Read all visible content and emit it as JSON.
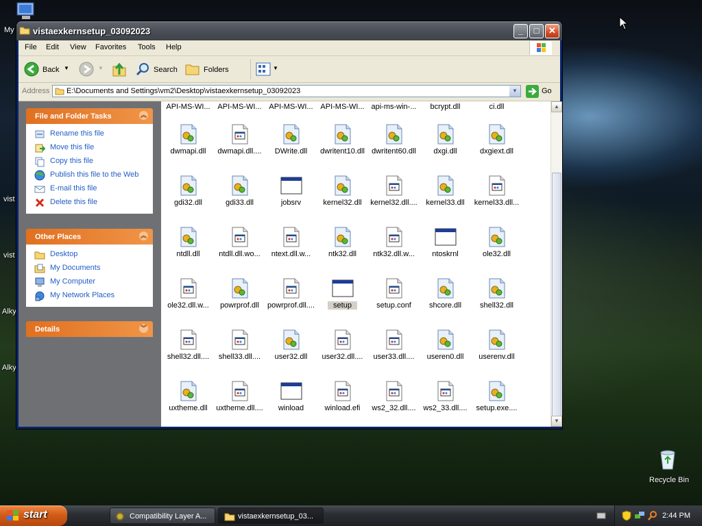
{
  "desktop": {
    "labels": [
      "My",
      "vist",
      "vist",
      "Alky",
      "Alky"
    ],
    "recycle_bin": "Recycle Bin"
  },
  "window": {
    "title": "vistaexkernsetup_03092023",
    "controls": {
      "minimize": "_",
      "maximize": "□",
      "close": "✕"
    },
    "menu": [
      "File",
      "Edit",
      "View",
      "Favorites",
      "Tools",
      "Help"
    ],
    "toolbar": {
      "back": "Back",
      "search": "Search",
      "folders": "Folders"
    },
    "address": {
      "label": "Address",
      "path": "E:\\Documents and Settings\\vm2\\Desktop\\vistaexkernsetup_03092023",
      "go": "Go"
    }
  },
  "sidebar": {
    "file_tasks": {
      "title": "File and Folder Tasks",
      "items": [
        "Rename this file",
        "Move this file",
        "Copy this file",
        "Publish this file to the Web",
        "E-mail this file",
        "Delete this file"
      ]
    },
    "other_places": {
      "title": "Other Places",
      "items": [
        "Desktop",
        "My Documents",
        "My Computer",
        "My Network Places"
      ]
    },
    "details": {
      "title": "Details"
    }
  },
  "files": {
    "top_row": [
      "API-MS-WI...",
      "API-MS-WI...",
      "API-MS-WI...",
      "API-MS-WI...",
      "api-ms-win-...",
      "bcrypt.dll",
      "ci.dll"
    ],
    "rows": [
      [
        {
          "name": "dwmapi.dll",
          "type": "dll"
        },
        {
          "name": "dwmapi.dll....",
          "type": "doc"
        },
        {
          "name": "DWrite.dll",
          "type": "dll"
        },
        {
          "name": "dwritent10.dll",
          "type": "dll"
        },
        {
          "name": "dwritent60.dll",
          "type": "dll"
        },
        {
          "name": "dxgi.dll",
          "type": "dll"
        },
        {
          "name": "dxgiext.dll",
          "type": "dll"
        }
      ],
      [
        {
          "name": "gdi32.dll",
          "type": "dll"
        },
        {
          "name": "gdi33.dll",
          "type": "dll"
        },
        {
          "name": "jobsrv",
          "type": "exe"
        },
        {
          "name": "kernel32.dll",
          "type": "dll"
        },
        {
          "name": "kernel32.dll....",
          "type": "doc"
        },
        {
          "name": "kernel33.dll",
          "type": "dll"
        },
        {
          "name": "kernel33.dll...",
          "type": "doc"
        }
      ],
      [
        {
          "name": "ntdll.dll",
          "type": "dll"
        },
        {
          "name": "ntdll.dll.wo...",
          "type": "doc"
        },
        {
          "name": "ntext.dll.w...",
          "type": "doc"
        },
        {
          "name": "ntk32.dll",
          "type": "dll"
        },
        {
          "name": "ntk32.dll.w...",
          "type": "doc"
        },
        {
          "name": "ntoskrnl",
          "type": "exe"
        },
        {
          "name": "ole32.dll",
          "type": "dll"
        }
      ],
      [
        {
          "name": "ole32.dll.w...",
          "type": "doc"
        },
        {
          "name": "powrprof.dll",
          "type": "dll"
        },
        {
          "name": "powrprof.dll....",
          "type": "doc"
        },
        {
          "name": "setup",
          "type": "exe",
          "selected": true
        },
        {
          "name": "setup.conf",
          "type": "doc"
        },
        {
          "name": "shcore.dll",
          "type": "dll"
        },
        {
          "name": "shell32.dll",
          "type": "dll"
        }
      ],
      [
        {
          "name": "shell32.dll....",
          "type": "doc"
        },
        {
          "name": "shell33.dll....",
          "type": "doc"
        },
        {
          "name": "user32.dll",
          "type": "dll"
        },
        {
          "name": "user32.dll....",
          "type": "doc"
        },
        {
          "name": "user33.dll....",
          "type": "doc"
        },
        {
          "name": "useren0.dll",
          "type": "dll"
        },
        {
          "name": "userenv.dll",
          "type": "dll"
        }
      ],
      [
        {
          "name": "uxtheme.dll",
          "type": "dll"
        },
        {
          "name": "uxtheme.dll....",
          "type": "doc"
        },
        {
          "name": "winload",
          "type": "exe"
        },
        {
          "name": "winload.efi",
          "type": "doc"
        },
        {
          "name": "ws2_32.dll....",
          "type": "doc"
        },
        {
          "name": "ws2_33.dll....",
          "type": "doc"
        },
        {
          "name": "setup.exe....",
          "type": "dll"
        }
      ]
    ]
  },
  "taskbar": {
    "start": "start",
    "tasks": [
      {
        "label": "Compatibility Layer A...",
        "active": false
      },
      {
        "label": "vistaexkernsetup_03...",
        "active": true
      }
    ],
    "clock": "2:44 PM"
  },
  "colors": {
    "accent": "#e07020",
    "link": "#215dc6",
    "selection": "#d4d0c8"
  }
}
